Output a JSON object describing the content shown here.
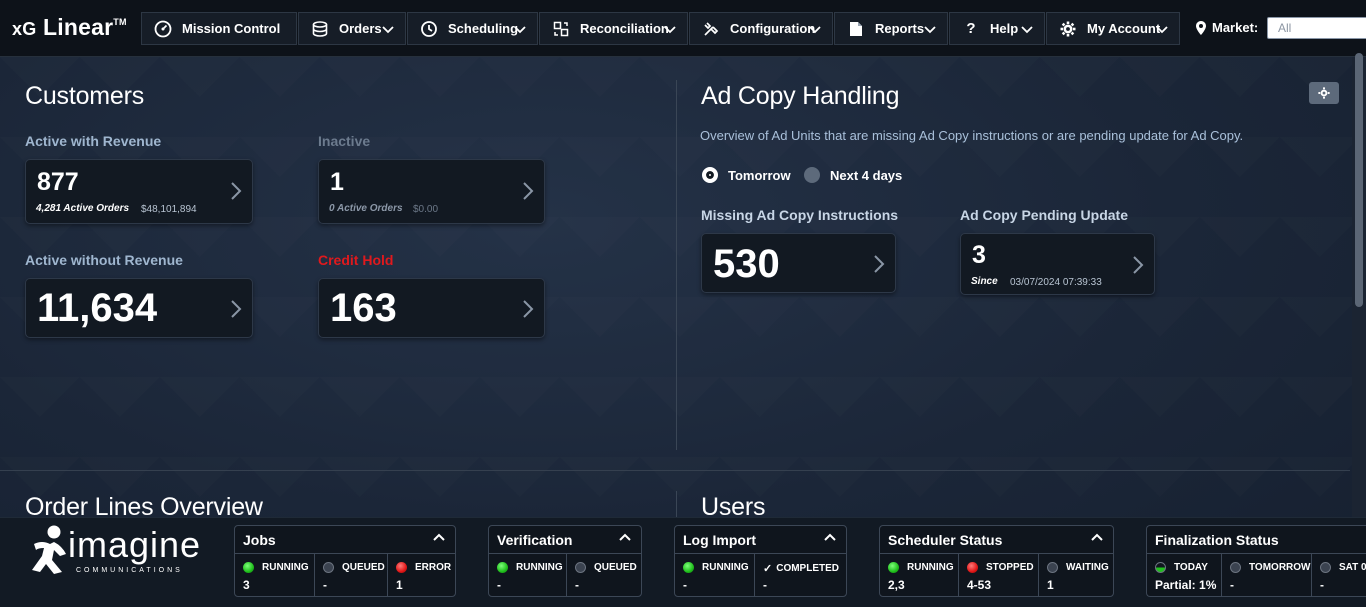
{
  "app": {
    "name": "xG",
    "name2": "Linear",
    "tm": "TM"
  },
  "nav": [
    {
      "label": "Mission Control",
      "icon": "gauge-icon"
    },
    {
      "label": "Orders",
      "icon": "database-icon"
    },
    {
      "label": "Scheduling",
      "icon": "clock-icon"
    },
    {
      "label": "Reconciliation",
      "icon": "reconcile-icon"
    },
    {
      "label": "Configuration",
      "icon": "tools-icon"
    },
    {
      "label": "Reports",
      "icon": "document-icon"
    },
    {
      "label": "Help",
      "icon": "question-icon"
    },
    {
      "label": "My Account",
      "icon": "gear-icon"
    }
  ],
  "market": {
    "label": "Market:",
    "value": "All"
  },
  "customers": {
    "title": "Customers",
    "active_with_revenue": {
      "label": "Active with Revenue",
      "count": "877",
      "orders": "4,281 Active Orders",
      "amount": "$48,101,894"
    },
    "inactive": {
      "label": "Inactive",
      "count": "1",
      "orders": "0 Active Orders",
      "amount": "$0.00"
    },
    "active_without_revenue": {
      "label": "Active without Revenue",
      "count": "11,634"
    },
    "credit_hold": {
      "label": "Credit Hold",
      "count": "163"
    }
  },
  "ad_copy": {
    "title": "Ad Copy Handling",
    "description": "Overview of Ad Units that are missing Ad Copy instructions or are pending update for Ad Copy.",
    "options": [
      "Tomorrow",
      "Next 4 days"
    ],
    "selected": "Tomorrow",
    "missing": {
      "label": "Missing Ad Copy Instructions",
      "count": "530"
    },
    "pending": {
      "label": "Ad Copy Pending Update",
      "count": "3",
      "since_label": "Since",
      "since": "03/07/2024 07:39:33"
    }
  },
  "lower": {
    "order_lines_title": "Order Lines Overview",
    "users_title": "Users"
  },
  "footer": {
    "brand": "imagine",
    "brand_sub": "COMMUNICATIONS",
    "panels": [
      {
        "title": "Jobs",
        "cells": [
          {
            "status": "RUNNING",
            "color": "green",
            "value": "3"
          },
          {
            "status": "QUEUED",
            "color": "grey",
            "value": "-"
          },
          {
            "status": "ERROR",
            "color": "red",
            "value": "1"
          }
        ]
      },
      {
        "title": "Verification",
        "cells": [
          {
            "status": "RUNNING",
            "color": "green",
            "value": "-"
          },
          {
            "status": "QUEUED",
            "color": "grey",
            "value": "-"
          }
        ]
      },
      {
        "title": "Log Import",
        "cells": [
          {
            "status": "RUNNING",
            "color": "green",
            "value": "-"
          },
          {
            "status": "COMPLETED",
            "color": "check",
            "value": "-"
          }
        ]
      },
      {
        "title": "Scheduler Status",
        "cells": [
          {
            "status": "RUNNING",
            "color": "green",
            "value": "2,3"
          },
          {
            "status": "STOPPED",
            "color": "red",
            "value": "4-53"
          },
          {
            "status": "WAITING",
            "color": "grey",
            "value": "1"
          }
        ]
      },
      {
        "title": "Finalization Status",
        "cells": [
          {
            "status": "TODAY",
            "color": "half",
            "value": "Partial: 1%"
          },
          {
            "status": "TOMORROW",
            "color": "grey",
            "value": "-"
          },
          {
            "status": "SAT 0",
            "color": "grey",
            "value": "-"
          }
        ]
      }
    ]
  },
  "colors": {
    "accent_label": "#9fb6cf",
    "credit_hold": "#e0191d",
    "background": "#1a2332"
  }
}
